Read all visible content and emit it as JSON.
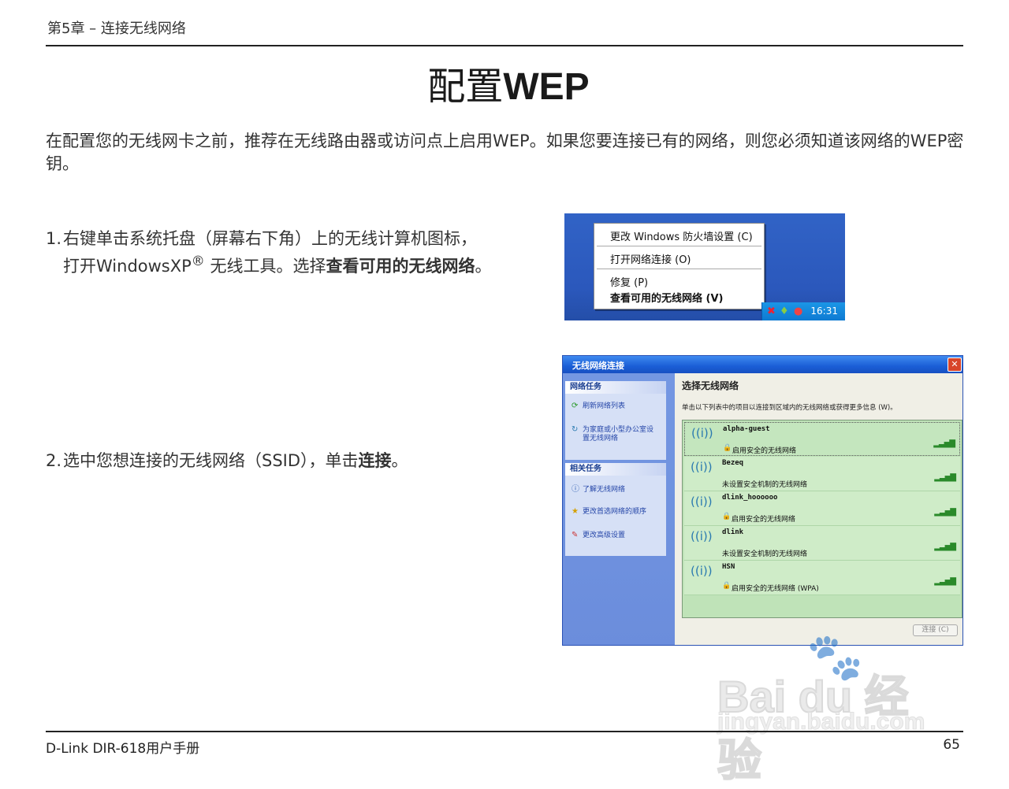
{
  "header": {
    "chapter": "第5章 – 连接无线网络"
  },
  "title": {
    "cn": "配置",
    "en": "WEP"
  },
  "intro": "在配置您的无线网卡之前，推荐在无线路由器或访问点上启用WEP。如果您要连接已有的网络，则您必须知道该网络的WEP密钥。",
  "steps": [
    {
      "num": "1.",
      "line1": "右键单击系统托盘（屏幕右下角）上的无线计算机图标，",
      "line2_pre": "打开WindowsXP",
      "reg": "®",
      "line2_mid": " 无线工具。选择",
      "line2_bold": "查看可用的无线网络",
      "line2_end": "。"
    },
    {
      "num": "2.",
      "pre": "选中您想连接的无线网络（SSID），单击",
      "bold": "连接",
      "end": "。"
    }
  ],
  "context_menu": {
    "items": [
      "更改 Windows 防火墙设置 (C)",
      "打开网络连接 (O)",
      "修复 (P)",
      "查看可用的无线网络 (V)"
    ],
    "tray_time": "16:31"
  },
  "wireless_window": {
    "title": "无线网络连接",
    "close": "✕",
    "network_tasks": {
      "header": "网络任务",
      "items": [
        {
          "icon": "refresh-icon",
          "label": "刷新网络列表"
        },
        {
          "icon": "setup-icon",
          "label": "为家庭或小型办公室设",
          "label2": "置无线网络"
        }
      ]
    },
    "related_tasks": {
      "header": "相关任务",
      "items": [
        {
          "icon": "info-icon",
          "label": "了解无线网络"
        },
        {
          "icon": "star-icon",
          "label": "更改首选网络的顺序"
        },
        {
          "icon": "settings-icon",
          "label": "更改高级设置"
        }
      ]
    },
    "heading": "选择无线网络",
    "description": "单击以下列表中的项目以连接到区域内的无线网络或获得更多信息 (W)。",
    "networks": [
      {
        "ssid": "alpha-guest",
        "status": "启用安全的无线网络",
        "secured": true,
        "selected": true
      },
      {
        "ssid": "Bezeq",
        "status": "未设置安全机制的无线网络",
        "secured": false,
        "selected": false
      },
      {
        "ssid": "dlink_hoooooo",
        "status": "启用安全的无线网络",
        "secured": true,
        "selected": false
      },
      {
        "ssid": "dlink",
        "status": "未设置安全机制的无线网络",
        "secured": false,
        "selected": false
      },
      {
        "ssid": "HSN",
        "status": "启用安全的无线网络  (WPA)",
        "secured": true,
        "selected": false
      }
    ],
    "connect_button": "连接 (C)"
  },
  "footer": {
    "left": "D-Link DIR-618用户手册",
    "right": "65"
  },
  "watermark": {
    "logo": "Bai du 经验",
    "url": "jingyan.baidu.com"
  }
}
